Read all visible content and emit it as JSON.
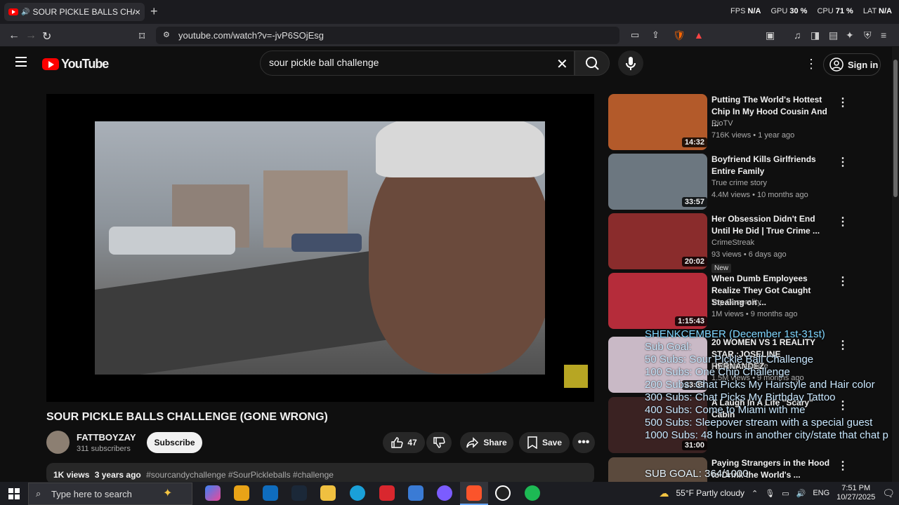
{
  "browser": {
    "tab_title": "SOUR PICKLE BALLS CHALLENGE",
    "new_tab": "+",
    "url": "youtube.com/watch?v=-jvP6SOjEsg",
    "perf": {
      "fps_label": "FPS",
      "fps": "N/A",
      "gpu_label": "GPU",
      "gpu": "30 %",
      "cpu_label": "CPU",
      "cpu": "71 %",
      "lat_label": "LAT",
      "lat": "N/A"
    }
  },
  "youtube": {
    "logo_text": "YouTube",
    "search_value": "sour pickle ball challenge",
    "sign_in": "Sign in"
  },
  "video": {
    "title": "SOUR PICKLE BALLS CHALLENGE (GONE WRONG)",
    "channel": "FATTBOYZAY",
    "subscribers": "311 subscribers",
    "subscribe": "Subscribe",
    "likes": "47",
    "share": "Share",
    "save": "Save",
    "views": "1K views",
    "age": "3 years ago",
    "tags": "#sourcandychallenge #SourPickleballs #challenge"
  },
  "recommendations": [
    {
      "title": "Putting The World's Hottest Chip In My Hood Cousin And ...",
      "channel": "RioTV",
      "meta": "716K views • 1 year ago",
      "duration": "14:32",
      "color": "#b35a2a"
    },
    {
      "title": "Boyfriend Kills Girlfriends Entire Family",
      "channel": "True crime story",
      "meta": "4.4M views • 10 months ago",
      "duration": "33:57",
      "color": "#6c7780"
    },
    {
      "title": "Her Obsession Didn't End Until He Did | True Crime ...",
      "channel": "CrimeStreak",
      "meta": "93 views • 6 days ago",
      "duration": "20:02",
      "color": "#8a2c2c",
      "badge": "New"
    },
    {
      "title": "When Dumb Employees Realize They Got Caught Stealing on ...",
      "channel": "Top Generality",
      "meta": "1M views • 9 months ago",
      "duration": "1:15:43",
      "color": "#b52c3a"
    },
    {
      "title": "20 WOMEN VS 1 REALITY STAR :JOSELINE HERNANDEZ",
      "channel": "Ryanwitdasauce",
      "meta": "1.5M views • 9 months ago",
      "duration": "33:39",
      "color": "#c9b9c6"
    },
    {
      "title": "A Laugh In A Life \"Scary\" Cabin",
      "channel": "",
      "meta": "",
      "duration": "31:00",
      "color": "#3a2222"
    },
    {
      "title": "Paying Strangers in the Hood to Drink the World's ...",
      "channel": "",
      "meta": "",
      "duration": "",
      "color": "#5b4a3d"
    }
  ],
  "overlay": {
    "header": "SHENKCEMBER (December 1st-31st)",
    "lines": [
      "Sub Goal:",
      "50 Subs: Sour Pickle Ball Challenge",
      "100 Subs: One Chip Challenge",
      "200 Subs: Chat Picks My Hairstyle and Hair color",
      "300 Subs: Chat Picks My Birthday Tattoo",
      "400 Subs: Come to Miami with me",
      "500 Subs: Sleepover stream with a special guest",
      "1000 Subs: 48 hours in another city/state that chat p"
    ],
    "sub_goal": "SUB GOAL: 364/1000"
  },
  "taskbar": {
    "search_placeholder": "Type here to search",
    "weather": "55°F  Partly cloudy",
    "lang": "ENG",
    "time": "7:51 PM",
    "date": "10/27/2025"
  }
}
